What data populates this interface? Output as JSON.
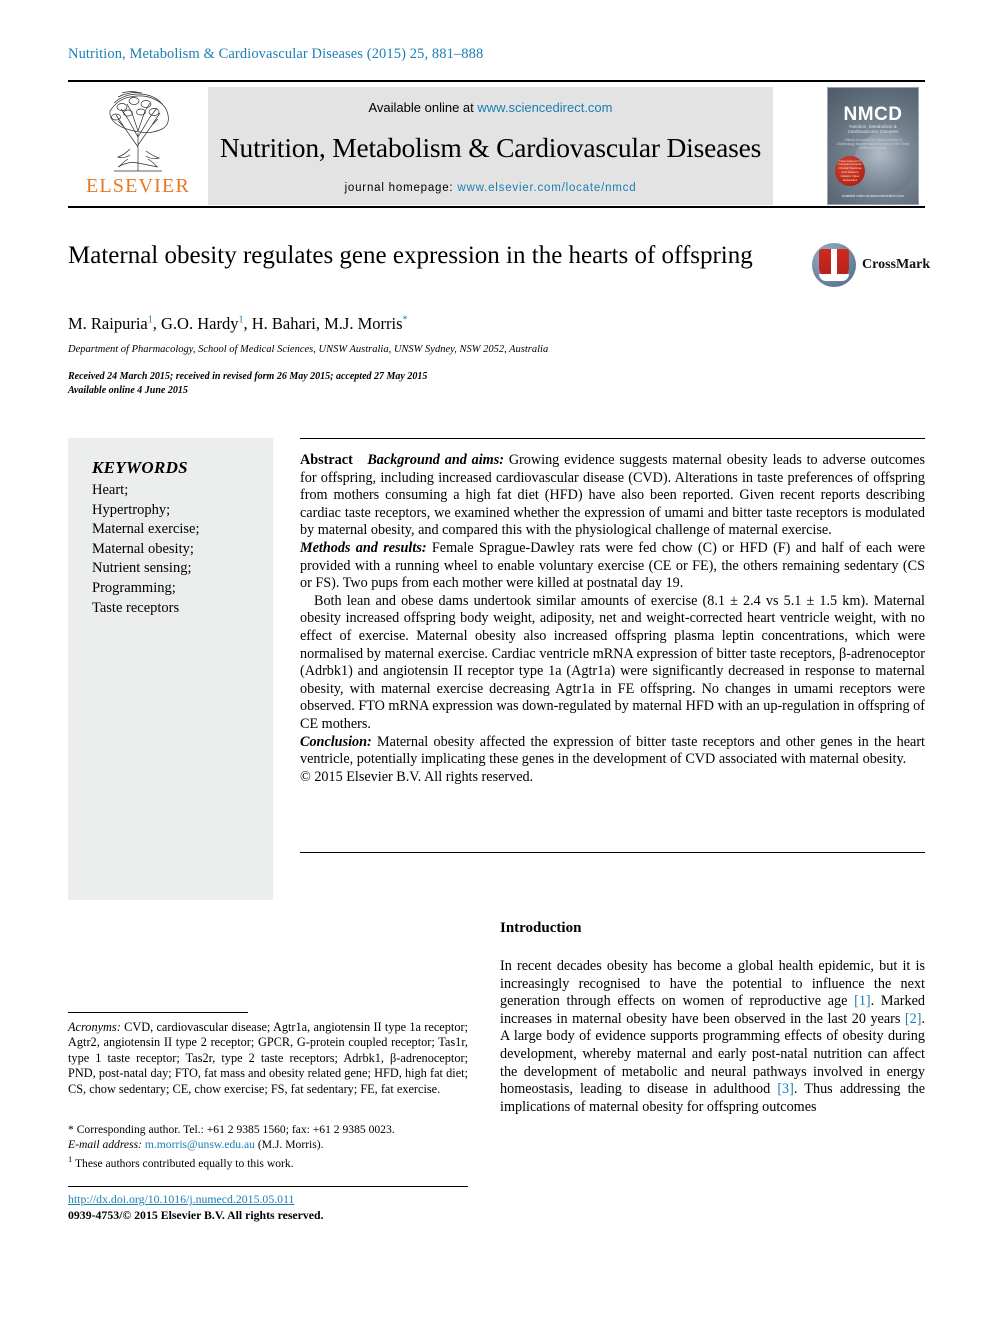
{
  "running_head": "Nutrition, Metabolism & Cardiovascular Diseases (2015) 25, 881–888",
  "colors": {
    "link": "#1a7fb3",
    "elsevier_orange": "#e87722",
    "banner_grey": "#e3e3e3",
    "keywords_panel": "#eceded",
    "crossmark_red": "#c0261d"
  },
  "masthead": {
    "publisher": "ELSEVIER",
    "available_prefix": "Available online at ",
    "available_url": "www.sciencedirect.com",
    "journal_title": "Nutrition, Metabolism & Cardiovascular Diseases",
    "homepage_prefix": "journal homepage: ",
    "homepage_url": "www.elsevier.com/locate/nmcd",
    "cover": {
      "acronym": "NMCD",
      "subtitle": "Nutrition, Metabolism & Cardiovascular Diseases",
      "tagline": "Official Journal of the Italian Society of Diabetology and the Italian Society for the Study of Atherosclerosis",
      "badge_text": "Now indexed in Current Contents Clinical Medicine and Science Citation Index Expanded",
      "footer": "Available online at www.sciencedirect.com"
    }
  },
  "article": {
    "title": "Maternal obesity regulates gene expression in the hearts of offspring",
    "authors": [
      {
        "name": "M. Raipuria",
        "marks": "1"
      },
      {
        "name": "G.O. Hardy",
        "marks": "1"
      },
      {
        "name": "H. Bahari",
        "marks": ""
      },
      {
        "name": "M.J. Morris",
        "marks": "*"
      }
    ],
    "authors_line": "M. Raipuria 1, G.O. Hardy 1, H. Bahari, M.J. Morris*",
    "affiliation": "Department of Pharmacology, School of Medical Sciences, UNSW Australia, UNSW Sydney, NSW 2052, Australia",
    "history": "Received 24 March 2015; received in revised form 26 May 2015; accepted 27 May 2015",
    "available_online": "Available online 4 June 2015",
    "crossmark_label": "CrossMark"
  },
  "keywords": {
    "heading": "KEYWORDS",
    "items": [
      "Heart;",
      "Hypertrophy;",
      "Maternal exercise;",
      "Maternal obesity;",
      "Nutrient sensing;",
      "Programming;",
      "Taste receptors"
    ]
  },
  "abstract": {
    "label": "Abstract",
    "background_label": "Background and aims:",
    "background_text": " Growing evidence suggests maternal obesity leads to adverse outcomes for offspring, including increased cardiovascular disease (CVD). Alterations in taste preferences of offspring from mothers consuming a high fat diet (HFD) have also been reported. Given recent reports describing cardiac taste receptors, we examined whether the expression of umami and bitter taste receptors is modulated by maternal obesity, and compared this with the physiological challenge of maternal exercise.",
    "methods_label": "Methods and results:",
    "methods_text": " Female Sprague-Dawley rats were fed chow (C) or HFD (F) and half of each were provided with a running wheel to enable voluntary exercise (CE or FE), the others remaining sedentary (CS or FS). Two pups from each mother were killed at postnatal day 19.",
    "results_text": "Both lean and obese dams undertook similar amounts of exercise (8.1 ± 2.4 vs 5.1 ± 1.5 km). Maternal obesity increased offspring body weight, adiposity, net and weight-corrected heart ventricle weight, with no effect of exercise. Maternal obesity also increased offspring plasma leptin concentrations, which were normalised by maternal exercise. Cardiac ventricle mRNA expression of bitter taste receptors, β-adrenoceptor (Adrbk1) and angiotensin II receptor type 1a (Agtr1a) were significantly decreased in response to maternal obesity, with maternal exercise decreasing Agtr1a in FE offspring. No changes in umami receptors were observed. FTO mRNA expression was down-regulated by maternal HFD with an up-regulation in offspring of CE mothers.",
    "conclusion_label": "Conclusion:",
    "conclusion_text": " Maternal obesity affected the expression of bitter taste receptors and other genes in the heart ventricle, potentially implicating these genes in the development of CVD associated with maternal obesity.",
    "copyright": "© 2015 Elsevier B.V. All rights reserved."
  },
  "footnotes": {
    "acronyms_label": "Acronyms:",
    "acronyms_text": " CVD, cardiovascular disease; Agtr1a, angiotensin II type 1a receptor; Agtr2, angiotensin II type 2 receptor; GPCR, G-protein coupled receptor; Tas1r, type 1 taste receptor; Tas2r, type 2 taste receptors; Adrbk1, β-adrenoceptor; PND, post-natal day; FTO, fat mass and obesity related gene; HFD, high fat diet; CS, chow sedentary; CE, chow exercise; FS, fat sedentary; FE, fat exercise.",
    "corresponding": "* Corresponding author. Tel.: +61 2 9385 1560; fax: +61 2 9385 0023.",
    "email_label": "E-mail address:",
    "email": "m.morris@unsw.edu.au",
    "email_suffix": " (M.J. Morris).",
    "equal_contrib_mark": "1",
    "equal_contrib": " These authors contributed equally to this work.",
    "doi": "http://dx.doi.org/10.1016/j.numecd.2015.05.011",
    "issn_line": "0939-4753/© 2015 Elsevier B.V. All rights reserved."
  },
  "introduction": {
    "heading": "Introduction",
    "paragraph_1a": "In recent decades obesity has become a global health epidemic, but it is increasingly recognised to have the potential to influence the next generation through effects on women of reproductive age ",
    "ref_1": "[1]",
    "paragraph_1b": ". Marked increases in maternal obesity have been observed in the last 20 years ",
    "ref_2": "[2]",
    "paragraph_1c": ". A large body of evidence supports programming effects of obesity during development, whereby maternal and early post-natal nutrition can affect the development of metabolic and neural pathways involved in energy homeostasis, leading to disease in adulthood ",
    "ref_3": "[3]",
    "paragraph_1d": ". Thus addressing the implications of maternal obesity for offspring outcomes"
  }
}
